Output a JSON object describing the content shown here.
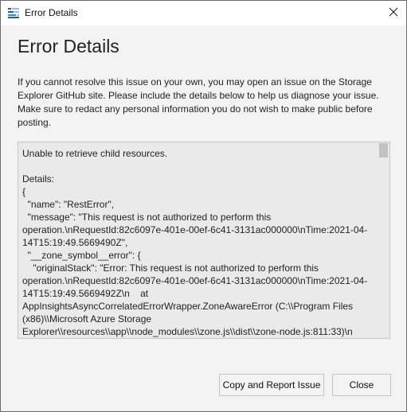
{
  "window": {
    "title": "Error Details"
  },
  "dialog": {
    "heading": "Error Details",
    "intro": "If you cannot resolve this issue on your own, you may open an issue on the Storage Explorer GitHub site. Please include the details below to help us diagnose your issue. Make sure to redact any personal information you do not wish to make public before posting.",
    "details": "Unable to retrieve child resources.\n\nDetails:\n{\n  \"name\": \"RestError\",\n  \"message\": \"This request is not authorized to perform this operation.\\nRequestId:82c6097e-401e-00ef-6c41-3131ac000000\\nTime:2021-04-14T15:19:49.5669490Z\",\n  \"__zone_symbol__error\": {\n    \"originalStack\": \"Error: This request is not authorized to perform this operation.\\nRequestId:82c6097e-401e-00ef-6c41-3131ac000000\\nTime:2021-04-14T15:19:49.5669492Z\\n    at AppInsightsAsyncCorrelatedErrorWrapper.ZoneAwareError (C:\\\\Program Files (x86)\\\\Microsoft Azure Storage Explorer\\\\resources\\\\app\\\\node_modules\\\\zone.js\\\\dist\\\\zone-node.js:811:33)\\n"
  },
  "buttons": {
    "report": "Copy and Report Issue",
    "close": "Close"
  },
  "icons": {
    "app": "storage-explorer-icon",
    "close": "close-icon"
  },
  "colors": {
    "background": "#f3f3f3",
    "titlebar": "#ffffff",
    "details_bg": "#eaeaea",
    "app_icon": "#2b579a"
  }
}
